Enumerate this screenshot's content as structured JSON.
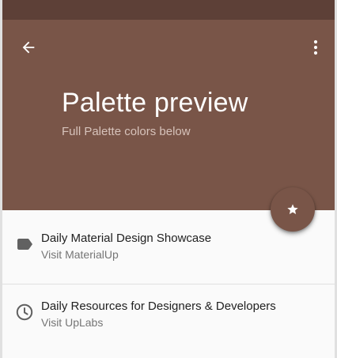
{
  "app_bar": {
    "title": "Palette preview",
    "subtitle": "Full Palette colors below",
    "back_icon": "arrow-back-icon",
    "more_icon": "more-vert-icon"
  },
  "fab": {
    "icon": "star-icon"
  },
  "list": {
    "items": [
      {
        "primary": "Daily Material Design Showcase",
        "secondary": "Visit MaterialUp",
        "icon": "label-icon"
      },
      {
        "primary": "Daily Resources for Designers & Developers",
        "secondary": "Visit UpLabs",
        "icon": "clock-icon"
      }
    ]
  },
  "colors": {
    "primary": "#795548",
    "primary_dark": "#5d4037",
    "background": "#fafafa",
    "text_primary": "#212121",
    "text_secondary": "#757575",
    "icon_grey": "#616161"
  }
}
